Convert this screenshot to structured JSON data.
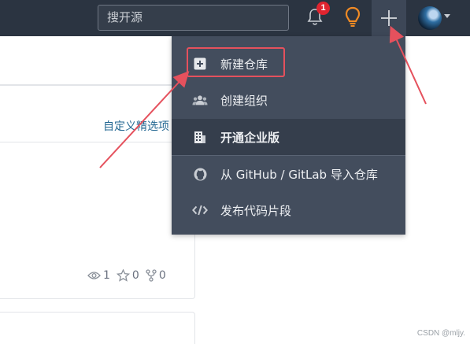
{
  "navbar": {
    "search_placeholder": "搜开源",
    "notification_count": "1",
    "icons": [
      "bell-icon",
      "lightbulb-icon",
      "plus-icon",
      "avatar",
      "caret-down-icon"
    ]
  },
  "background": {
    "customize_link": "自定义精选项",
    "stats": {
      "watch": "1",
      "star": "0",
      "fork": "0"
    }
  },
  "dropdown": {
    "items": [
      {
        "label": "新建仓库",
        "icon": "plus-square-icon"
      },
      {
        "label": "创建组织",
        "icon": "users-icon"
      },
      {
        "label": "开通企业版",
        "icon": "building-icon"
      },
      {
        "label": "从 GitHub / GitLab 导入仓库",
        "icon": "github-icon"
      },
      {
        "label": "发布代码片段",
        "icon": "code-icon"
      }
    ]
  },
  "watermark": "CSDN @mljy.",
  "colors": {
    "navbar": "#2b3441",
    "dropdown": "#434d5d",
    "annotation": "#e5515d",
    "bulb": "#f08a24",
    "badge": "#e0242f"
  }
}
